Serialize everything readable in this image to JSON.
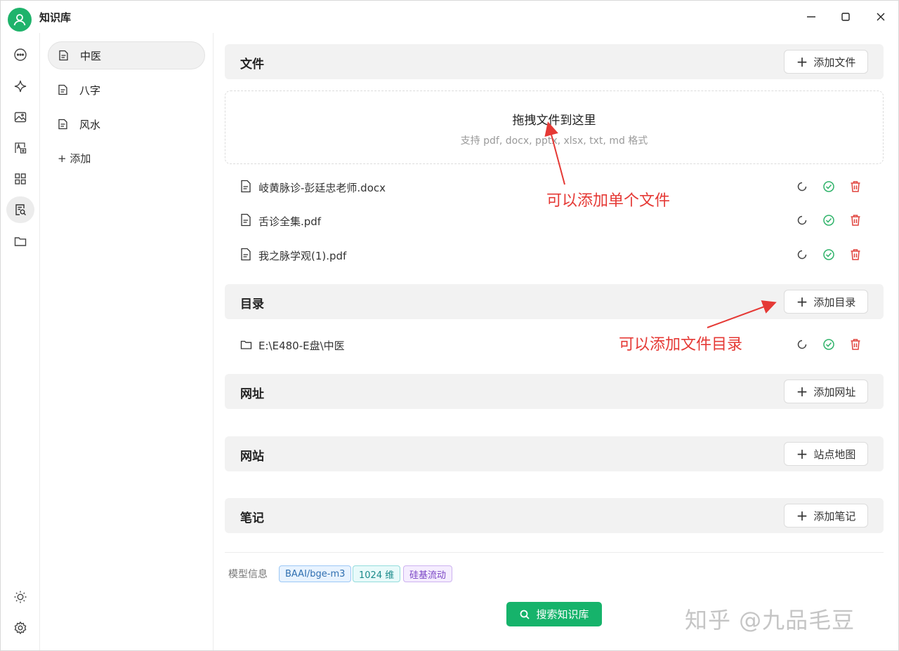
{
  "window": {
    "title": "知识库",
    "controls": {
      "minimize": "minimize",
      "maximize": "maximize",
      "close": "close"
    }
  },
  "rail": {
    "items": [
      {
        "icon": "chat-icon"
      },
      {
        "icon": "sparkle-icon"
      },
      {
        "icon": "image-icon"
      },
      {
        "icon": "translate-icon"
      },
      {
        "icon": "apps-grid-icon"
      },
      {
        "icon": "knowledge-search-icon",
        "active": true
      },
      {
        "icon": "folder-icon"
      }
    ],
    "bottom": [
      {
        "icon": "sun-icon"
      },
      {
        "icon": "gear-icon"
      }
    ]
  },
  "kb_list": {
    "items": [
      {
        "label": "中医",
        "active": true
      },
      {
        "label": "八字"
      },
      {
        "label": "风水"
      }
    ],
    "add_label": "+ 添加"
  },
  "files": {
    "title": "文件",
    "add_button": "添加文件",
    "drop_title": "拖拽文件到这里",
    "drop_sub": "支持 pdf, docx, pptx, xlsx, txt, md 格式",
    "items": [
      {
        "name": "岐黄脉诊-彭廷忠老师.docx"
      },
      {
        "name": "舌诊全集.pdf"
      },
      {
        "name": "我之脉学观(1).pdf"
      }
    ]
  },
  "directories": {
    "title": "目录",
    "add_button": "添加目录",
    "items": [
      {
        "name": "E:\\E480-E盘\\中医"
      }
    ]
  },
  "urls": {
    "title": "网址",
    "add_button": "添加网址"
  },
  "websites": {
    "title": "网站",
    "add_button": "站点地图"
  },
  "notes": {
    "title": "笔记",
    "add_button": "添加笔记"
  },
  "model_info": {
    "label": "模型信息",
    "tags": [
      "BAAI/bge-m3",
      "1024 维",
      "硅基流动"
    ]
  },
  "search_button": "搜索知识库",
  "annotations": {
    "single_file": "可以添加单个文件",
    "directory": "可以添加文件目录"
  },
  "watermark": "知乎 @九品毛豆",
  "colors": {
    "accent": "#16b36b",
    "success": "#2fb36a",
    "danger": "#e0443e",
    "annotation": "#e53935"
  }
}
